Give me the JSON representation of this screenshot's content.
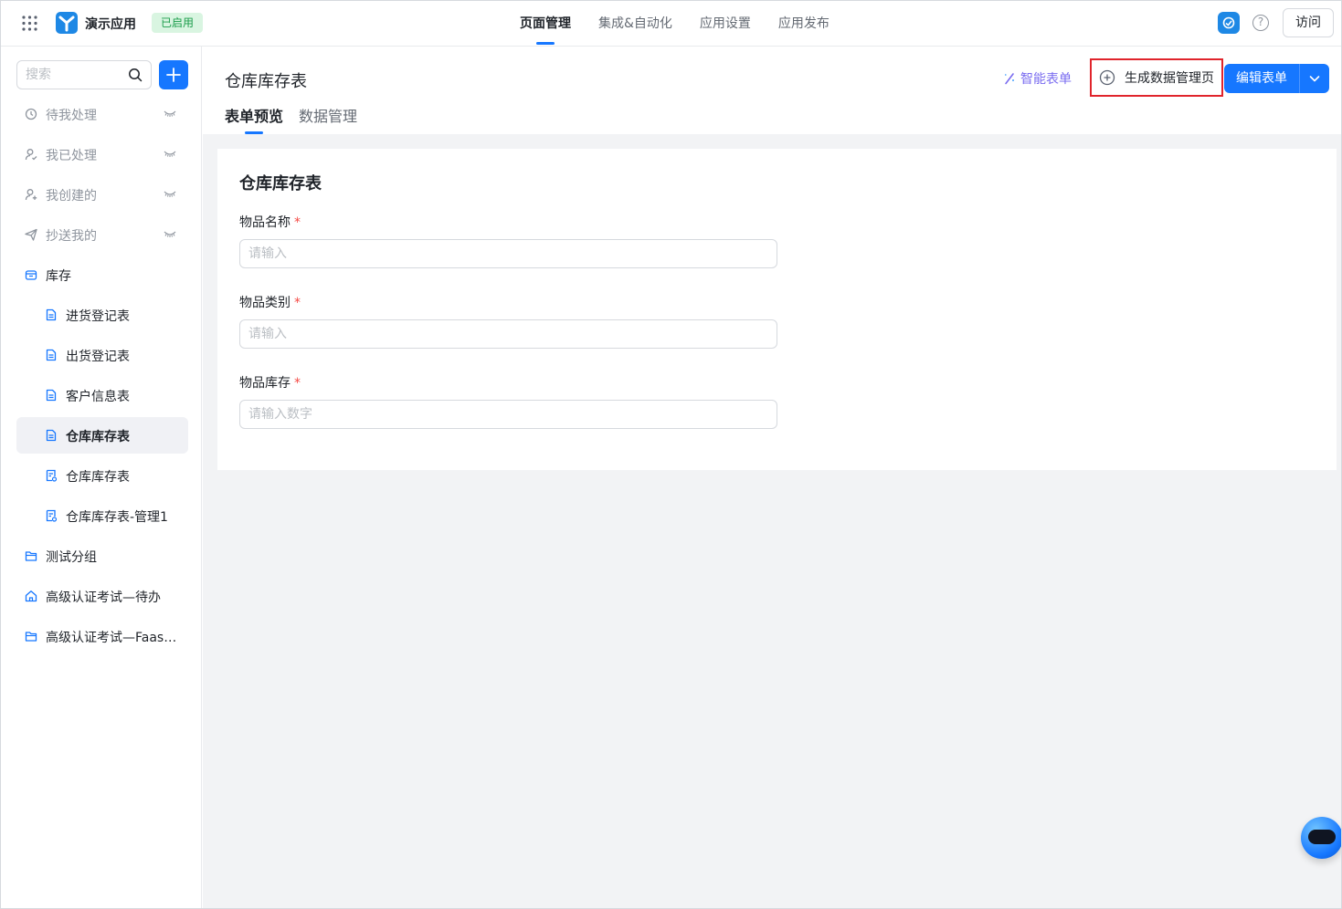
{
  "app": {
    "name": "演示应用",
    "status": "已启用",
    "colors": {
      "accent": "#1677ff",
      "status_bg": "#d9f5e1",
      "status_text": "#1a9c4a",
      "highlight_border": "#e0242c",
      "smart_link": "#7a6cf0"
    }
  },
  "top_nav": {
    "tabs": [
      {
        "label": "页面管理",
        "active": true
      },
      {
        "label": "集成&自动化",
        "active": false
      },
      {
        "label": "应用设置",
        "active": false
      },
      {
        "label": "应用发布",
        "active": false
      }
    ],
    "visit_label": "访问",
    "help_glyph": "?"
  },
  "sidebar": {
    "search_placeholder": "搜索",
    "items": [
      {
        "label": "待我处理",
        "icon": "clock-icon"
      },
      {
        "label": "我已处理",
        "icon": "user-check-icon"
      },
      {
        "label": "我创建的",
        "icon": "user-plus-icon"
      },
      {
        "label": "抄送我的",
        "icon": "send-icon"
      },
      {
        "label": "库存",
        "icon": "box-icon"
      },
      {
        "label": "进货登记表",
        "icon": "form-icon"
      },
      {
        "label": "出货登记表",
        "icon": "form-icon"
      },
      {
        "label": "客户信息表",
        "icon": "form-icon"
      },
      {
        "label": "仓库库存表",
        "icon": "form-icon",
        "active": true
      },
      {
        "label": "仓库库存表",
        "icon": "report-icon"
      },
      {
        "label": "仓库库存表-管理1",
        "icon": "report-icon"
      },
      {
        "label": "测试分组",
        "icon": "folder-icon"
      },
      {
        "label": "高级认证考试—待办",
        "icon": "home-icon"
      },
      {
        "label": "高级认证考试—Faas…",
        "icon": "folder-icon"
      }
    ]
  },
  "page": {
    "title": "仓库库存表",
    "smart_form_label": "智能表单",
    "generate_button_label": "生成数据管理页",
    "edit_button_label": "编辑表单",
    "sub_tabs": [
      {
        "label": "表单预览",
        "active": true
      },
      {
        "label": "数据管理",
        "active": false
      }
    ]
  },
  "form": {
    "title": "仓库库存表",
    "required_mark": "*",
    "fields": [
      {
        "label": "物品名称",
        "placeholder": "请输入"
      },
      {
        "label": "物品类别",
        "placeholder": "请输入"
      },
      {
        "label": "物品库存",
        "placeholder": "请输入数字"
      }
    ]
  }
}
